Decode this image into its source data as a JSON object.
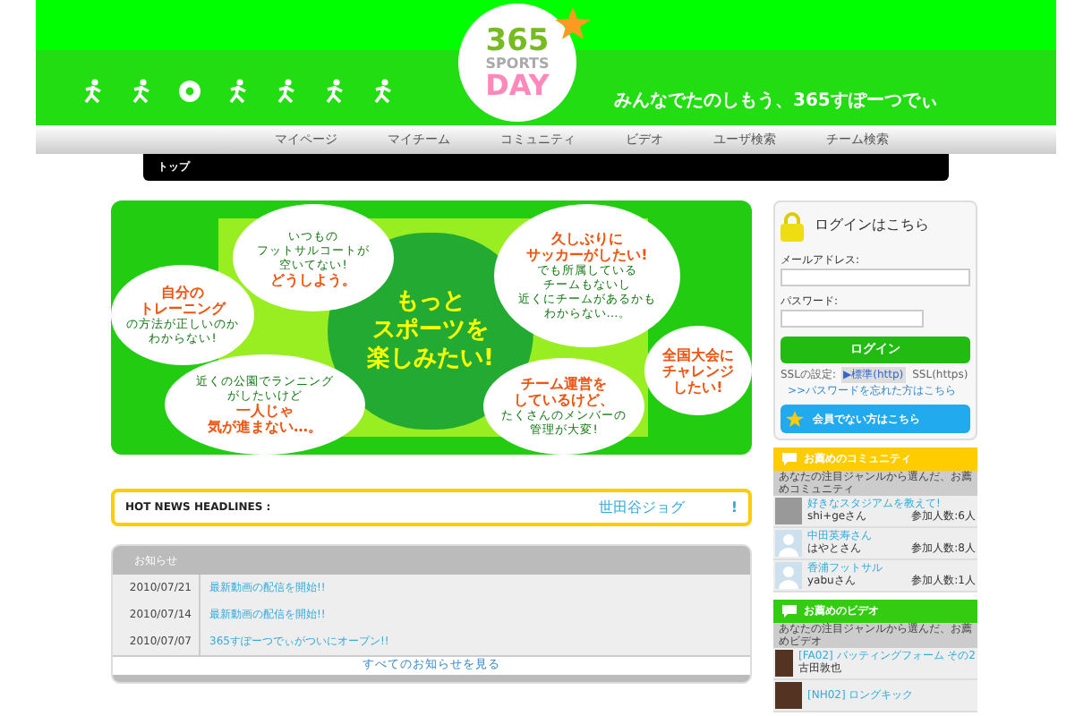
{
  "header": {
    "logo": {
      "number": "365",
      "word_top": "SPORTS",
      "word_bottom": "DAY"
    },
    "tagline": "みんなでたのしもう、365すぽーつでぃ"
  },
  "nav": {
    "items": [
      "マイページ",
      "マイチーム",
      "コミュニティ",
      "ビデオ",
      "ユーザ検索",
      "チーム検索"
    ]
  },
  "breadcrumb": "トップ",
  "banner": {
    "center": [
      "もっと",
      "スポーツを",
      "楽しみたい!"
    ],
    "bubbles": [
      {
        "lines": [
          {
            "text": "いつもの",
            "accent": false
          },
          {
            "text": "フットサルコートが",
            "accent": false
          },
          {
            "text": "空いてない!",
            "accent": false
          },
          {
            "text": "どうしよう。",
            "accent": true
          }
        ]
      },
      {
        "lines": [
          {
            "text": "自分の",
            "accent": true
          },
          {
            "text": "トレーニング",
            "accent": true
          },
          {
            "text": "の方法が正しいのか",
            "accent": false
          },
          {
            "text": "わからない!",
            "accent": false
          }
        ]
      },
      {
        "lines": [
          {
            "text": "近くの公園でランニング",
            "accent": false
          },
          {
            "text": "がしたいけど",
            "accent": false
          },
          {
            "text": "一人じゃ",
            "accent": true
          },
          {
            "text": "気が進まない…。",
            "accent": true
          }
        ]
      },
      {
        "lines": [
          {
            "text": "久しぶりに",
            "accent": true
          },
          {
            "text": "サッカーがしたい!",
            "accent": true
          },
          {
            "text": "でも所属している",
            "accent": false
          },
          {
            "text": "チームもないし",
            "accent": false
          },
          {
            "text": "近くにチームがあるかも",
            "accent": false
          },
          {
            "text": "わからない…。",
            "accent": false
          }
        ]
      },
      {
        "lines": [
          {
            "text": "全国大会に",
            "accent": true
          },
          {
            "text": "チャレンジ",
            "accent": true
          },
          {
            "text": "したい!",
            "accent": true
          }
        ]
      },
      {
        "lines": [
          {
            "text": "チーム運営を",
            "accent": true
          },
          {
            "text": "しているけど、",
            "accent": true
          },
          {
            "text": "たくさんのメンバーの",
            "accent": false
          },
          {
            "text": "管理が大変!",
            "accent": false
          }
        ]
      }
    ]
  },
  "news": {
    "label": "HOT NEWS HEADLINES :",
    "headline": "世田谷ジョグ",
    "mark": "!"
  },
  "notices": {
    "title": "お知らせ",
    "rows": [
      {
        "date": "2010/07/21",
        "text": "最新動画の配信を開始!!"
      },
      {
        "date": "2010/07/14",
        "text": "最新動画の配信を開始!!"
      },
      {
        "date": "2010/07/07",
        "text": "365すぽーつでぃがついにオープン!!"
      }
    ],
    "more": "すべてのお知らせを見る"
  },
  "login": {
    "title": "ログインはこちら",
    "email_label": "メールアドレス:",
    "password_label": "パスワード:",
    "button": "ログイン",
    "ssl_label": "SSLの設定:",
    "ssl_options": [
      {
        "label": "▶標準(http)",
        "selected": true
      },
      {
        "label": "SSL(https)",
        "selected": false
      }
    ],
    "forgot": ">>パスワードを忘れた方はこちら",
    "register": "会員でない方はこちら"
  },
  "community": {
    "title": "お薦めのコミュニティ",
    "subtitle": "あなたの注目ジャンルから選んだ、お薦めコミュニティ",
    "items": [
      {
        "title": "好きなスタジアムを教えて!",
        "user": "shi+geさん",
        "members": "参加人数:6人",
        "kind": "photo"
      },
      {
        "title": "中田英寿さん",
        "user": "はやとさん",
        "members": "参加人数:8人",
        "kind": "silhouette"
      },
      {
        "title": "香浦フットサル",
        "user": "yabuさん",
        "members": "参加人数:1人",
        "kind": "silhouette"
      }
    ]
  },
  "videos": {
    "title": "お薦めのビデオ",
    "subtitle": "あなたの注目ジャンルから選んだ、お薦めビデオ",
    "items": [
      {
        "title": "[FA02] バッティングフォーム その2",
        "author": "古田敦也"
      },
      {
        "title": "[NH02] ロングキック"
      }
    ]
  }
}
